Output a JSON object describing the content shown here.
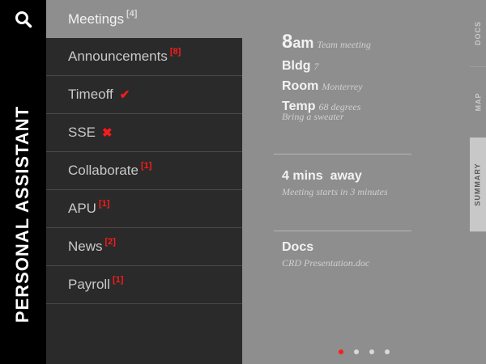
{
  "app": {
    "title": "PERSONAL ASSISTANT",
    "search_icon": "search-icon"
  },
  "menu": {
    "items": [
      {
        "label": "Meetings",
        "badge": "[4]",
        "active": true
      },
      {
        "label": "Announcements",
        "badge": "[8]"
      },
      {
        "label": "Timeoff",
        "status": "✔",
        "status_icon": "check-icon"
      },
      {
        "label": "SSE",
        "status": "✖",
        "status_icon": "cross-icon"
      },
      {
        "label": "Collaborate",
        "badge": "[1]"
      },
      {
        "label": "APU",
        "badge": "[1]"
      },
      {
        "label": "News",
        "badge": "[2]"
      },
      {
        "label": "Payroll",
        "badge": "[1]"
      }
    ]
  },
  "meeting": {
    "time": "8",
    "ampm": "am",
    "title": "Team meeting",
    "bldg_label": "Bldg",
    "bldg_value": "7",
    "room_label": "Room",
    "room_value": "Monterrey",
    "temp_label": "Temp",
    "temp_value": "68 degrees",
    "temp_note": "Bring a sweater"
  },
  "travel": {
    "label": "4 mins  away",
    "note": "Meeting starts in 3 minutes"
  },
  "docs": {
    "label": "Docs",
    "file": "CRD Presentation.doc"
  },
  "tabs": {
    "docs": "DOCS",
    "map": "MAP",
    "summary": "SUMMARY",
    "active": "summary"
  },
  "pager": {
    "count": 4,
    "active": 1
  },
  "colors": {
    "accent": "#ff1a1a",
    "sidebar": "#000000",
    "menu_bg": "#2a2a2a",
    "panel_bg": "#8e8e8e"
  }
}
